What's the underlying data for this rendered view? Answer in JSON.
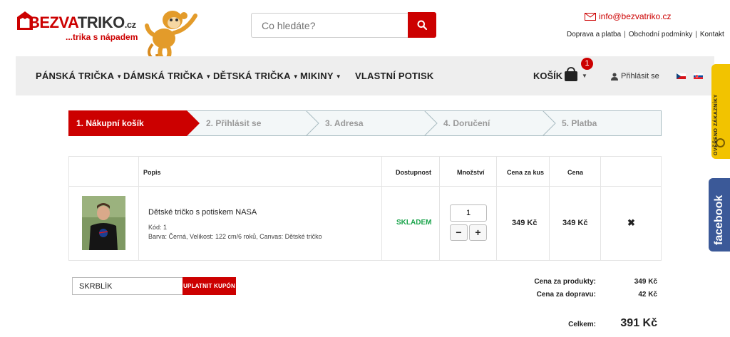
{
  "header": {
    "logo_text_a": "BEZVA",
    "logo_text_b": "TRIKO",
    "logo_text_cz": ".cz",
    "logo_tagline": "...trika s nápadem",
    "search_placeholder": "Co hledáte?",
    "email": "info@bezvatriko.cz",
    "top_links": [
      "Doprava a platba",
      "Obchodní podmínky",
      "Kontakt"
    ]
  },
  "nav": {
    "items": [
      "PÁNSKÁ TRIČKA",
      "DÁMSKÁ TRIČKA",
      "DĚTSKÁ TRIČKA",
      "MIKINY",
      "VLASTNÍ POTISK"
    ],
    "cart_label": "KOŠÍK",
    "cart_count": "1",
    "login_label": "Přihlásit se"
  },
  "side": {
    "verified": "OVĚŘENO ZÁKAZNÍKY",
    "facebook": "facebook"
  },
  "steps": [
    "1. Nákupní košík",
    "2. Přihlásit se",
    "3. Adresa",
    "4. Doručení",
    "5. Platba"
  ],
  "table": {
    "headers": {
      "desc": "Popis",
      "availability": "Dostupnost",
      "quantity": "Množství",
      "unit_price": "Cena za kus",
      "price": "Cena"
    },
    "item": {
      "name": "Dětské tričko s potiskem NASA",
      "code": "Kód: 1",
      "variant": "Barva: Černá, Velikost: 122 cm/6 roků, Canvas: Dětské tričko",
      "availability": "SKLADEM",
      "quantity": "1",
      "minus": "−",
      "plus": "+",
      "unit_price": "349 Kč",
      "price": "349 Kč",
      "remove": "✖"
    }
  },
  "coupon": {
    "value": "SKRBLÍK",
    "button": "UPLATNIT KUPÓN"
  },
  "summary": {
    "products_label": "Cena za produkty:",
    "products_value": "349 Kč",
    "shipping_label": "Cena za dopravu:",
    "shipping_value": "42 Kč",
    "total_label": "Celkem:",
    "total_value": "391 Kč"
  },
  "colors": {
    "brand": "#cc0000",
    "stock": "#19a34a",
    "facebook": "#3b5998",
    "verified": "#f2c300"
  }
}
